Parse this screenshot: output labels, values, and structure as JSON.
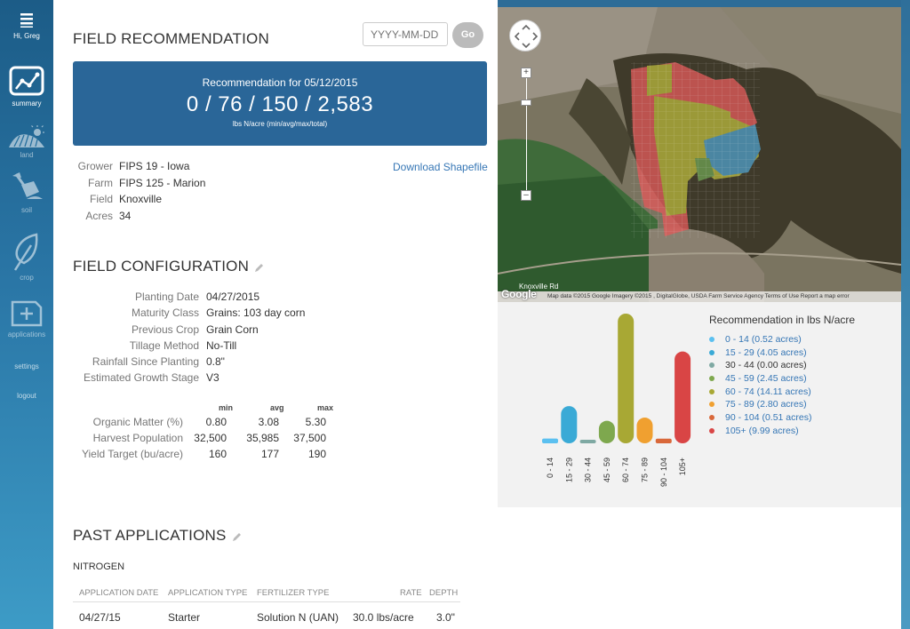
{
  "user": {
    "greeting": "Hi, Greg"
  },
  "nav": {
    "summary": "summary",
    "land": "land",
    "soil": "soil",
    "crop": "crop",
    "applications": "applications",
    "settings": "settings",
    "logout": "logout"
  },
  "header": {
    "title": "FIELD RECOMMENDATION",
    "date_placeholder": "YYYY-MM-DD",
    "go_label": "Go"
  },
  "recommendation": {
    "line1": "Recommendation for 05/12/2015",
    "values": "0 / 76 / 150 / 2,583",
    "units": "lbs N/acre (min/avg/max/total)"
  },
  "field_info": {
    "grower_label": "Grower",
    "grower": "FIPS 19 - Iowa",
    "farm_label": "Farm",
    "farm": "FIPS 125 - Marion",
    "field_label": "Field",
    "field": "Knoxville",
    "acres_label": "Acres",
    "acres": "34",
    "download_link": "Download Shapefile"
  },
  "config": {
    "title": "FIELD CONFIGURATION",
    "rows": [
      {
        "label": "Planting Date",
        "value": "04/27/2015"
      },
      {
        "label": "Maturity Class",
        "value": "Grains: 103 day corn"
      },
      {
        "label": "Previous Crop",
        "value": "Grain Corn"
      },
      {
        "label": "Tillage Method",
        "value": "No-Till"
      },
      {
        "label": "Rainfall Since Planting",
        "value": "0.8\""
      },
      {
        "label": "Estimated Growth Stage",
        "value": "V3"
      }
    ]
  },
  "stats": {
    "headers": {
      "min": "min",
      "avg": "avg",
      "max": "max"
    },
    "rows": [
      {
        "label": "Organic Matter (%)",
        "min": "0.80",
        "avg": "3.08",
        "max": "5.30"
      },
      {
        "label": "Harvest Population",
        "min": "32,500",
        "avg": "35,985",
        "max": "37,500"
      },
      {
        "label": "Yield Target (bu/acre)",
        "min": "160",
        "avg": "177",
        "max": "190"
      }
    ]
  },
  "past_applications": {
    "title": "PAST APPLICATIONS",
    "subtitle": "NITROGEN",
    "columns": {
      "date": "APPLICATION DATE",
      "type": "APPLICATION TYPE",
      "fertilizer": "FERTILIZER TYPE",
      "rate": "RATE",
      "depth": "DEPTH"
    },
    "rows": [
      {
        "date": "04/27/15",
        "type": "Starter",
        "fertilizer": "Solution N (UAN)",
        "rate": "30.0 lbs/acre",
        "depth": "3.0\""
      }
    ]
  },
  "map": {
    "google": "Google",
    "attribution": "Map data ©2015 Google Imagery ©2015 , DigitalGlobe, USDA Farm Service Agency   Terms of Use   Report a map error",
    "road_label": "Knoxville Rd"
  },
  "chart_data": {
    "type": "bar",
    "title": "Recommendation in lbs N/acre",
    "categories": [
      "0 - 14",
      "15 - 29",
      "30 - 44",
      "45 - 59",
      "60 - 74",
      "75 - 89",
      "90 - 104",
      "105+"
    ],
    "values": [
      0.52,
      4.05,
      0.0,
      2.45,
      14.11,
      2.8,
      0.51,
      9.99
    ],
    "legend": [
      "0 - 14 (0.52 acres)",
      "15 - 29 (4.05 acres)",
      "30 - 44 (0.00 acres)",
      "45 - 59 (2.45 acres)",
      "60 - 74 (14.11 acres)",
      "75 - 89 (2.80 acres)",
      "90 - 104 (0.51 acres)",
      "105+ (9.99 acres)"
    ],
    "colors": [
      "#5bc0f0",
      "#3aaad6",
      "#7fa9a3",
      "#7ea84e",
      "#a8a834",
      "#f0a030",
      "#d9683a",
      "#d94545"
    ],
    "legend_text_colors": [
      "#3576b5",
      "#3576b5",
      "#333333",
      "#3576b5",
      "#3576b5",
      "#3576b5",
      "#3576b5",
      "#3576b5"
    ],
    "ylim": [
      0,
      14.11
    ],
    "legend_position": "right"
  }
}
